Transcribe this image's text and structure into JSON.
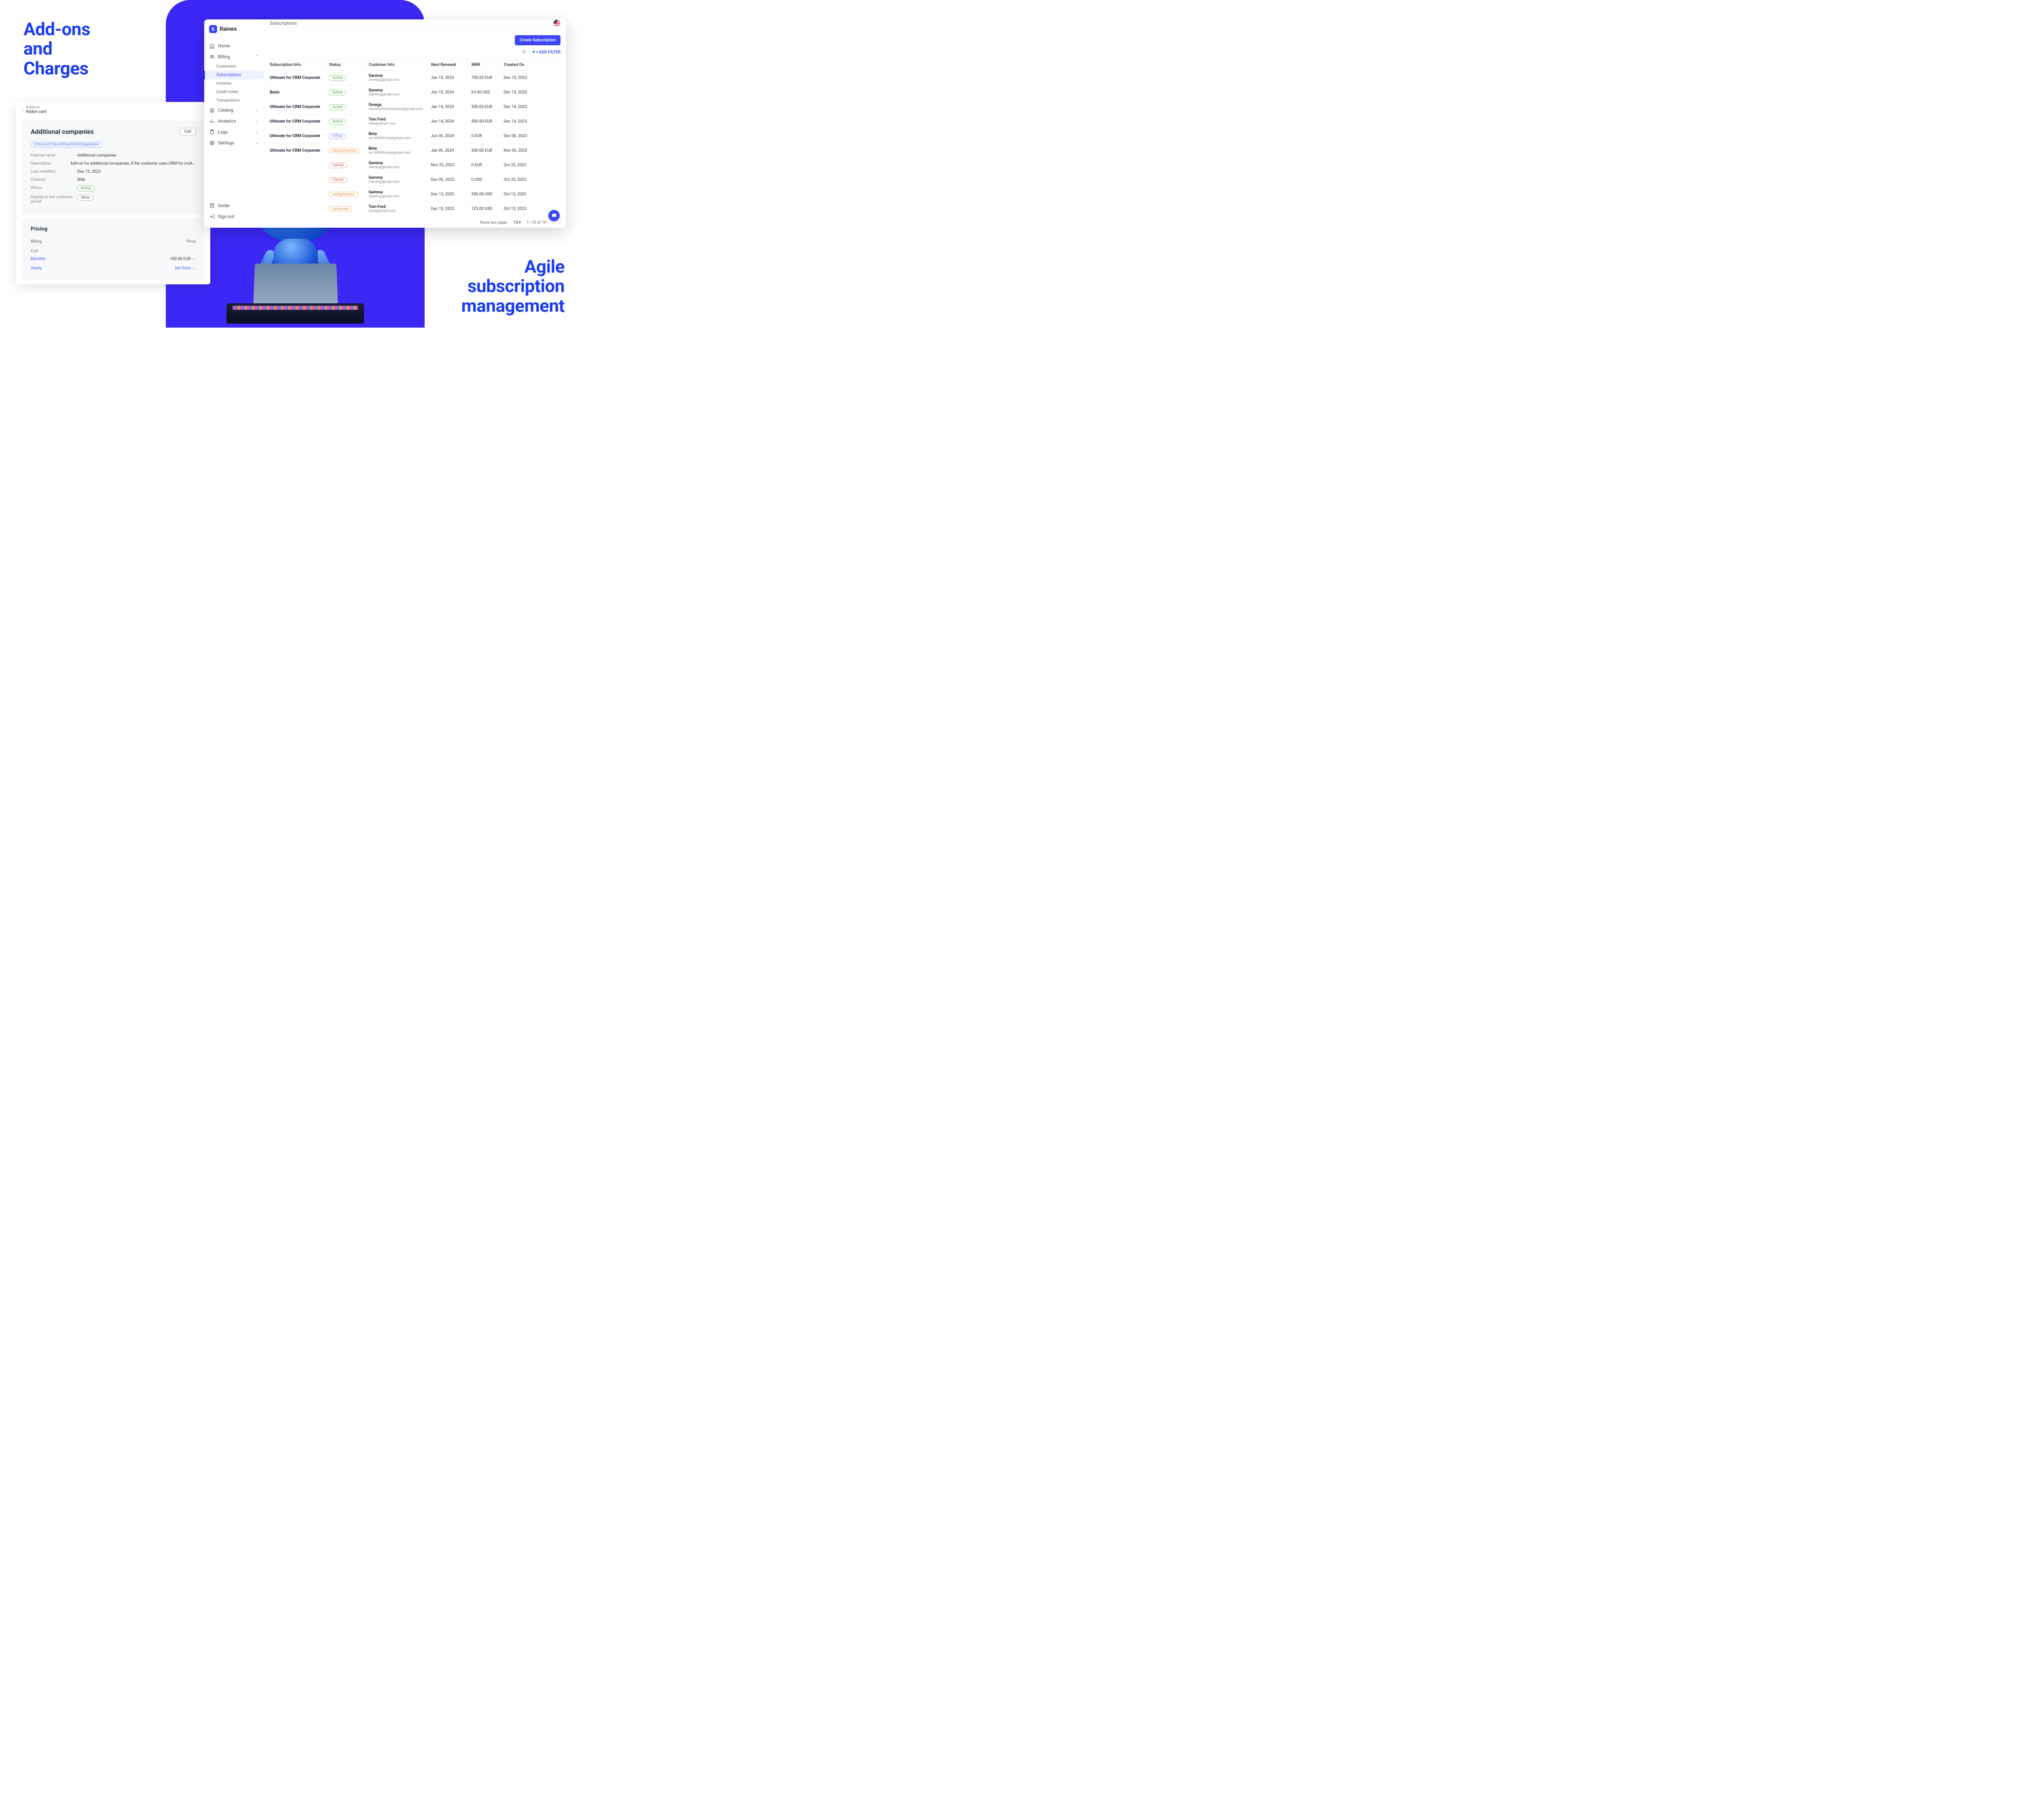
{
  "headlines": {
    "left": "Add-ons\nand\nCharges",
    "right": "Agile\nsubscription\nmanagement"
  },
  "addon_window": {
    "breadcrumb_top": "Addons",
    "breadcrumb_bottom": "Addon card",
    "title": "Additional companies",
    "edit_label": "Edit",
    "id_pill": "07b3c4d27d4c4593a9f95d255da54644",
    "details": {
      "internal_name_label": "Internal name",
      "internal_name": "Additional companies",
      "description_label": "Description",
      "description": "Add-on for additional companies, if the customer uses CRM for multiple business entities",
      "last_modified_label": "Last modified",
      "last_modified": "Dec 13, 2023",
      "channel_label": "Channel",
      "channel": "Web",
      "status_label": "Status",
      "status": "Active",
      "display_label": "Display in the customer portal",
      "display": "Show"
    },
    "pricing": {
      "title": "Pricing",
      "billing_header": "Billing",
      "price_header": "Price",
      "currency": "EUR",
      "rows": [
        {
          "period": "Monthly",
          "price": "100.00 EUR →"
        },
        {
          "period": "Yearly",
          "price": "Set Price →"
        }
      ]
    }
  },
  "main_window": {
    "brand": "Rainex",
    "page_title": "Subscriptions",
    "nav": {
      "home": "Home",
      "billing": "Billing",
      "subs": {
        "customers": "Customers",
        "subscriptions": "Subscriptions",
        "invoices": "Invoices",
        "credit_notes": "Credit notes",
        "transactions": "Transactions"
      },
      "catalog": "Catalog",
      "analytics": "Analytics",
      "logs": "Logs",
      "settings": "Settings",
      "guide": "Guide",
      "sign_out": "Sign out"
    },
    "actions": {
      "create": "Create Subscription",
      "add_filter": "▼+ ADD FILTER"
    },
    "columns": {
      "info": "Subscription Info",
      "status": "Status",
      "customer": "Customer Info",
      "renewal": "Next Renewal",
      "mrr": "MRR",
      "created": "Created On"
    },
    "rows": [
      {
        "name": "Ultimate for CRM Corporate",
        "status": "Active",
        "cust": "Gamma",
        "email": "clients@gmail.com",
        "renewal": "Jan 15, 2024",
        "mrr": "700.00 EUR",
        "created": "Dec 15, 2023"
      },
      {
        "name": "Basic",
        "status": "Active",
        "cust": "Gamma",
        "email": "clients@gmail.com",
        "renewal": "Jan 15, 2024",
        "mrr": "63.00 USD",
        "created": "Dec 15, 2023"
      },
      {
        "name": "Ultimate for CRM Corporate",
        "status": "Active",
        "cust": "Omega",
        "email": "successfullnessness@gmail.com",
        "renewal": "Jan 14, 2024",
        "mrr": "500.00 EUR",
        "created": "Dec 14, 2023"
      },
      {
        "name": "Ultimate for CRM Corporate",
        "status": "Active",
        "cust": "Tom Ford",
        "email": "new@gmail.com",
        "renewal": "Jan 14, 2024",
        "mrr": "500.00 EUR",
        "created": "Dec 14, 2023"
      },
      {
        "name": "Ultimate for CRM Corporate",
        "status": "InTrial",
        "cust": "Beta",
        "email": "su140984vas@gmail.com",
        "renewal": "Jun 06, 2024",
        "mrr": "0 EUR",
        "created": "Dec 06, 2023"
      },
      {
        "name": "Ultimate for CRM Corporate",
        "status": "PendingPayment",
        "cust": "Beta",
        "email": "su140984vas@gmail.com",
        "renewal": "Jan 06, 2024",
        "mrr": "200.00 EUR",
        "created": "Nov 06, 2023"
      },
      {
        "name": "",
        "status": "Cancel",
        "cust": "Gamma",
        "email": "clients@gmail.com",
        "renewal": "Nov 25, 2023",
        "mrr": "0 EUR",
        "created": "Oct 25, 2023"
      },
      {
        "name": "",
        "status": "Cancel",
        "cust": "Gamma",
        "email": "clients@gmail.com",
        "renewal": "Dec 06, 2023",
        "mrr": "0 USD",
        "created": "Oct 25, 2023"
      },
      {
        "name": "",
        "status": "endingPayment",
        "cust": "Gamma",
        "email": "clients@gmail.com",
        "renewal": "Dec 13, 2023",
        "mrr": "250.00 USD",
        "created": "Oct 13, 2023"
      },
      {
        "name": "",
        "status": "ngPayment",
        "cust": "Tom Ford",
        "email": "new@gmail.com",
        "renewal": "Dec 13, 2023",
        "mrr": "125.00 USD",
        "created": "Oct 13, 2023"
      }
    ],
    "pager": {
      "rows_per_page_label": "Rows per page:",
      "rows_per_page": "10 ▾",
      "range": "1–10 of 14"
    }
  }
}
